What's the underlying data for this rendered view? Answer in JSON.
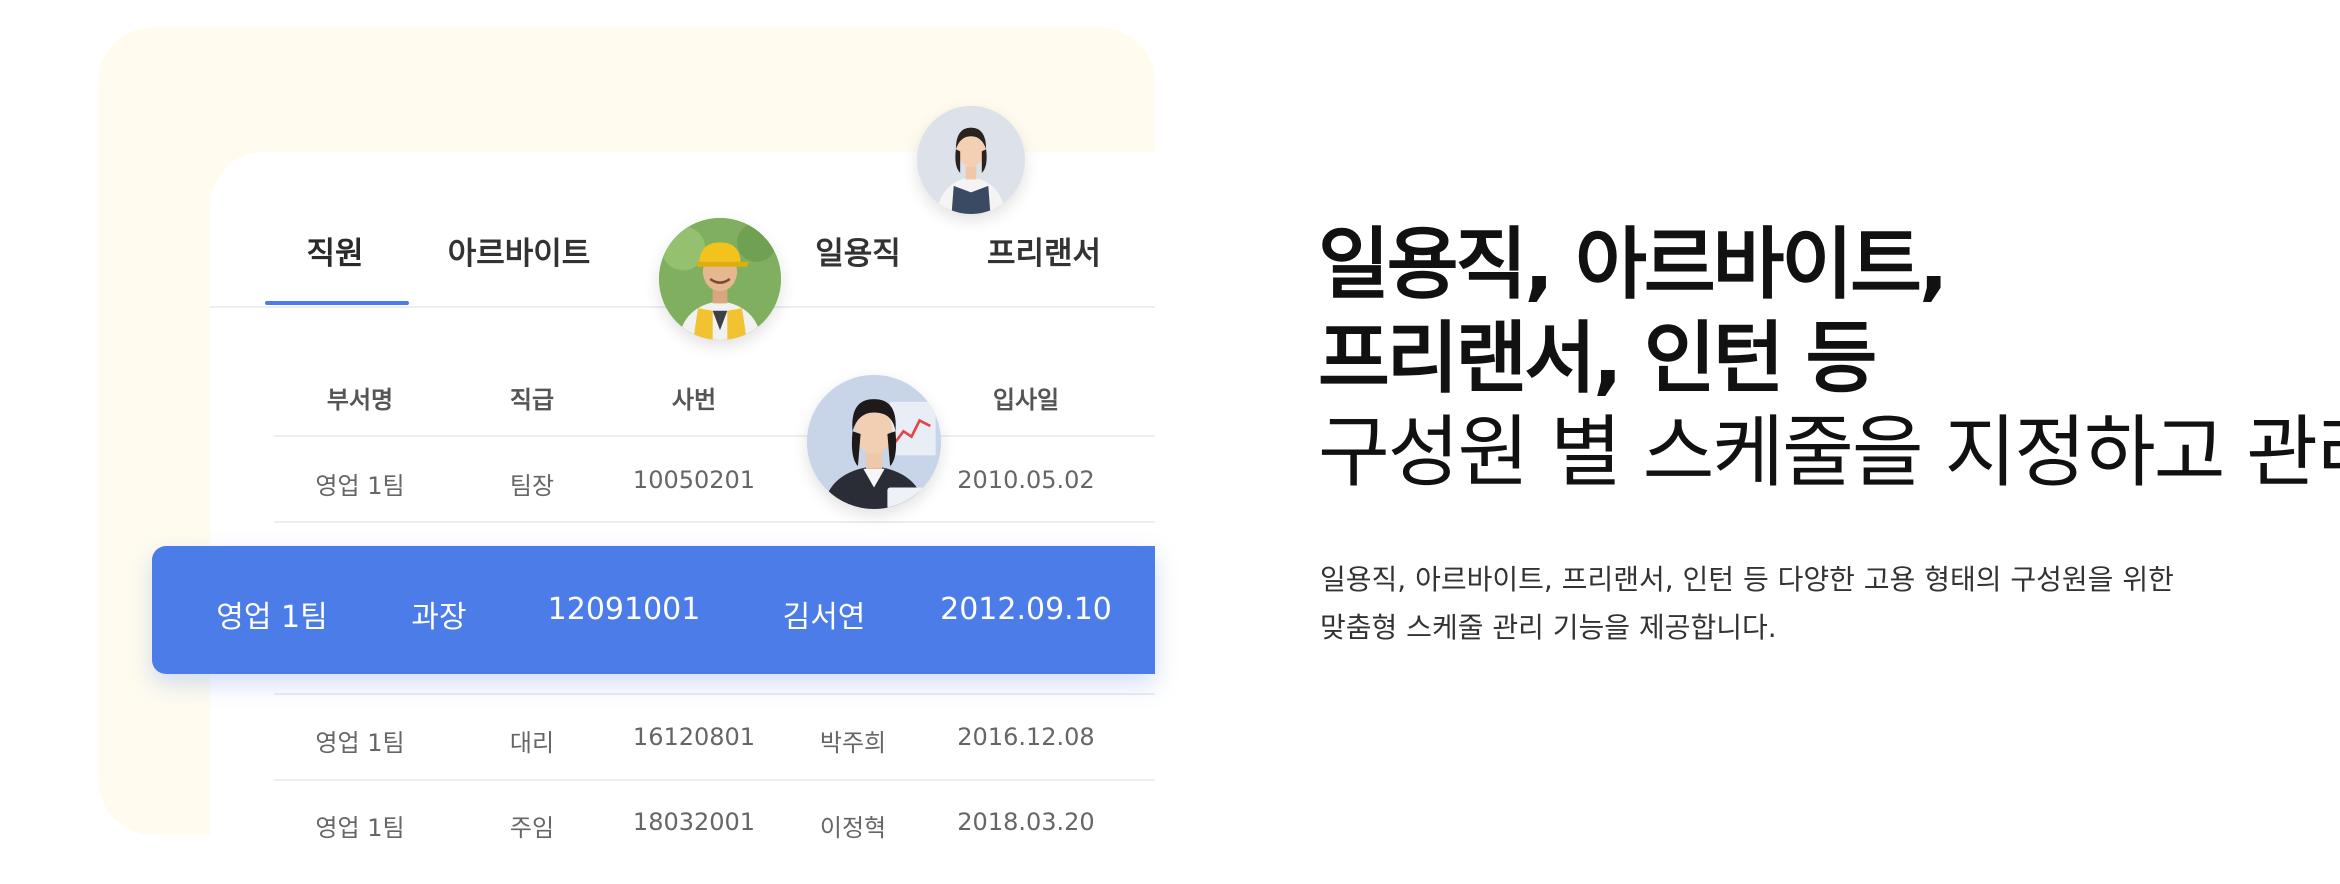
{
  "tabs": [
    {
      "label": "직원",
      "active": true
    },
    {
      "label": "아르바이트",
      "active": false
    },
    {
      "label": "일용직",
      "active": false
    },
    {
      "label": "프리랜서",
      "active": false
    }
  ],
  "table": {
    "headers": [
      "부서명",
      "직급",
      "사번",
      "입사일"
    ],
    "rows": [
      {
        "dept": "영업 1팀",
        "rank": "팀장",
        "id": "10050201",
        "name": "",
        "date": "2010.05.02"
      },
      {
        "dept": "영업 1팀",
        "rank": "과장",
        "id": "12091001",
        "name": "김서연",
        "date": "2012.09.10",
        "highlighted": true
      },
      {
        "dept": "영업 1팀",
        "rank": "대리",
        "id": "16120801",
        "name": "박주희",
        "date": "2016.12.08"
      },
      {
        "dept": "영업 1팀",
        "rank": "주임",
        "id": "18032001",
        "name": "이정혁",
        "date": "2018.03.20"
      }
    ]
  },
  "heading": {
    "line1": "일용직, 아르바이트,",
    "line2": "프리랜서, 인턴 등",
    "line3": "구성원 별 스케줄을 지정하고 관리"
  },
  "description": {
    "line1": "일용직, 아르바이트, 프리랜서, 인턴 등 다양한 고용 형태의 구성원을 위한",
    "line2": "맞춤형 스케줄 관리 기능을 제공합니다."
  },
  "colors": {
    "accent": "#4b7ce8",
    "card_bg": "#fffcef"
  },
  "icons": [
    "avatar-worker-apron",
    "avatar-worker-cap",
    "avatar-office-woman"
  ]
}
